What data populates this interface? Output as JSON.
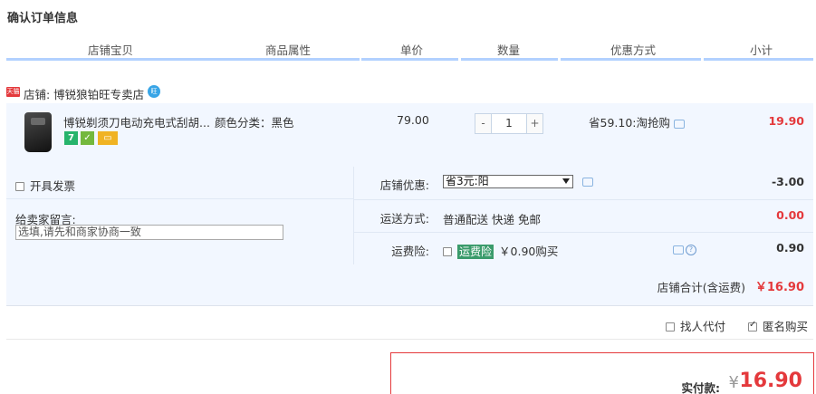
{
  "page_title": "确认订单信息",
  "columns": [
    "店铺宝贝",
    "商品属性",
    "单价",
    "数量",
    "优惠方式",
    "小计"
  ],
  "colors": {
    "accent_red": "#e4393c",
    "header_bar": "#b2d1ff",
    "panel_bg": "#f2f7ff",
    "insurance_tag": "#3a9b6b"
  },
  "shop": {
    "label": "店铺: 博锐狼铂旺专卖店",
    "badge_icon": "tmall-badge-icon",
    "chat_icon": "wangwang-icon"
  },
  "item": {
    "title": "博锐剃须刀电动充电式刮胡...",
    "attribute": "颜色分类：黑色",
    "unit_price": "79.00",
    "quantity": "1",
    "qty_minus": "-",
    "qty_plus": "+",
    "discount": "省59.10:淘抢购",
    "subtotal": "19.90",
    "service_icons": [
      "seven-day-return-icon",
      "genuine-guarantee-icon",
      "credit-card-icon"
    ]
  },
  "invoice_label": "开具发票",
  "message": {
    "label": "给卖家留言:",
    "placeholder": "选填,请先和商家协商一致"
  },
  "shop_discount": {
    "label": "店铺优惠:",
    "selected": "省3元:阳",
    "value": "-3.00"
  },
  "shipping": {
    "label": "运送方式:",
    "method": "普通配送 快递 免邮",
    "value": "0.00"
  },
  "insurance": {
    "label": "运费险:",
    "tag": "运费险",
    "desc": "￥0.90购买",
    "value": "0.90"
  },
  "shop_total": {
    "label": "店铺合计(含运费)",
    "value": "￥16.90"
  },
  "options": {
    "proxy_pay": "找人代付",
    "anonymous": "匿名购买"
  },
  "payment": {
    "label": "实付款:",
    "currency": "¥",
    "value": "16.90"
  }
}
